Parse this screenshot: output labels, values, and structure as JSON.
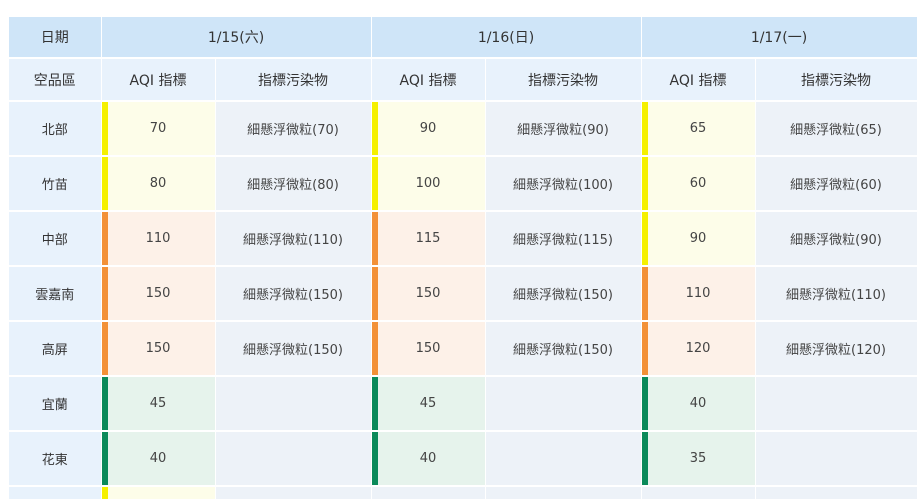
{
  "table": {
    "date_label": "日期",
    "region_label": "空品區",
    "aqi_label": "AQI 指標",
    "pollutant_label": "指標污染物",
    "days": [
      {
        "date": "1/15(六)"
      },
      {
        "date": "1/16(日)"
      },
      {
        "date": "1/17(一)"
      }
    ],
    "level_colors": {
      "yellow": "#f5f000",
      "orange": "#f39137",
      "green": "#0b8a5a"
    },
    "rows": [
      {
        "region": "北部",
        "cells": [
          {
            "aqi": "70",
            "level": "yellow",
            "pollutant": "細懸浮微粒(70)"
          },
          {
            "aqi": "90",
            "level": "yellow",
            "pollutant": "細懸浮微粒(90)"
          },
          {
            "aqi": "65",
            "level": "yellow",
            "pollutant": "細懸浮微粒(65)"
          }
        ]
      },
      {
        "region": "竹苗",
        "cells": [
          {
            "aqi": "80",
            "level": "yellow",
            "pollutant": "細懸浮微粒(80)"
          },
          {
            "aqi": "100",
            "level": "yellow",
            "pollutant": "細懸浮微粒(100)"
          },
          {
            "aqi": "60",
            "level": "yellow",
            "pollutant": "細懸浮微粒(60)"
          }
        ]
      },
      {
        "region": "中部",
        "cells": [
          {
            "aqi": "110",
            "level": "orange",
            "pollutant": "細懸浮微粒(110)"
          },
          {
            "aqi": "115",
            "level": "orange",
            "pollutant": "細懸浮微粒(115)"
          },
          {
            "aqi": "90",
            "level": "yellow",
            "pollutant": "細懸浮微粒(90)"
          }
        ]
      },
      {
        "region": "雲嘉南",
        "cells": [
          {
            "aqi": "150",
            "level": "orange",
            "pollutant": "細懸浮微粒(150)"
          },
          {
            "aqi": "150",
            "level": "orange",
            "pollutant": "細懸浮微粒(150)"
          },
          {
            "aqi": "110",
            "level": "orange",
            "pollutant": "細懸浮微粒(110)"
          }
        ]
      },
      {
        "region": "高屏",
        "cells": [
          {
            "aqi": "150",
            "level": "orange",
            "pollutant": "細懸浮微粒(150)"
          },
          {
            "aqi": "150",
            "level": "orange",
            "pollutant": "細懸浮微粒(150)"
          },
          {
            "aqi": "120",
            "level": "orange",
            "pollutant": "細懸浮微粒(120)"
          }
        ]
      },
      {
        "region": "宜蘭",
        "cells": [
          {
            "aqi": "45",
            "level": "green",
            "pollutant": ""
          },
          {
            "aqi": "45",
            "level": "green",
            "pollutant": ""
          },
          {
            "aqi": "40",
            "level": "green",
            "pollutant": ""
          }
        ]
      },
      {
        "region": "花東",
        "cells": [
          {
            "aqi": "40",
            "level": "green",
            "pollutant": ""
          },
          {
            "aqi": "40",
            "level": "green",
            "pollutant": ""
          },
          {
            "aqi": "35",
            "level": "green",
            "pollutant": ""
          }
        ]
      },
      {
        "region": "",
        "cells": [
          {
            "aqi": "",
            "level": "yellow",
            "pollutant": ""
          },
          {
            "aqi": "",
            "level": "",
            "pollutant": ""
          },
          {
            "aqi": "",
            "level": "",
            "pollutant": ""
          }
        ]
      }
    ]
  }
}
